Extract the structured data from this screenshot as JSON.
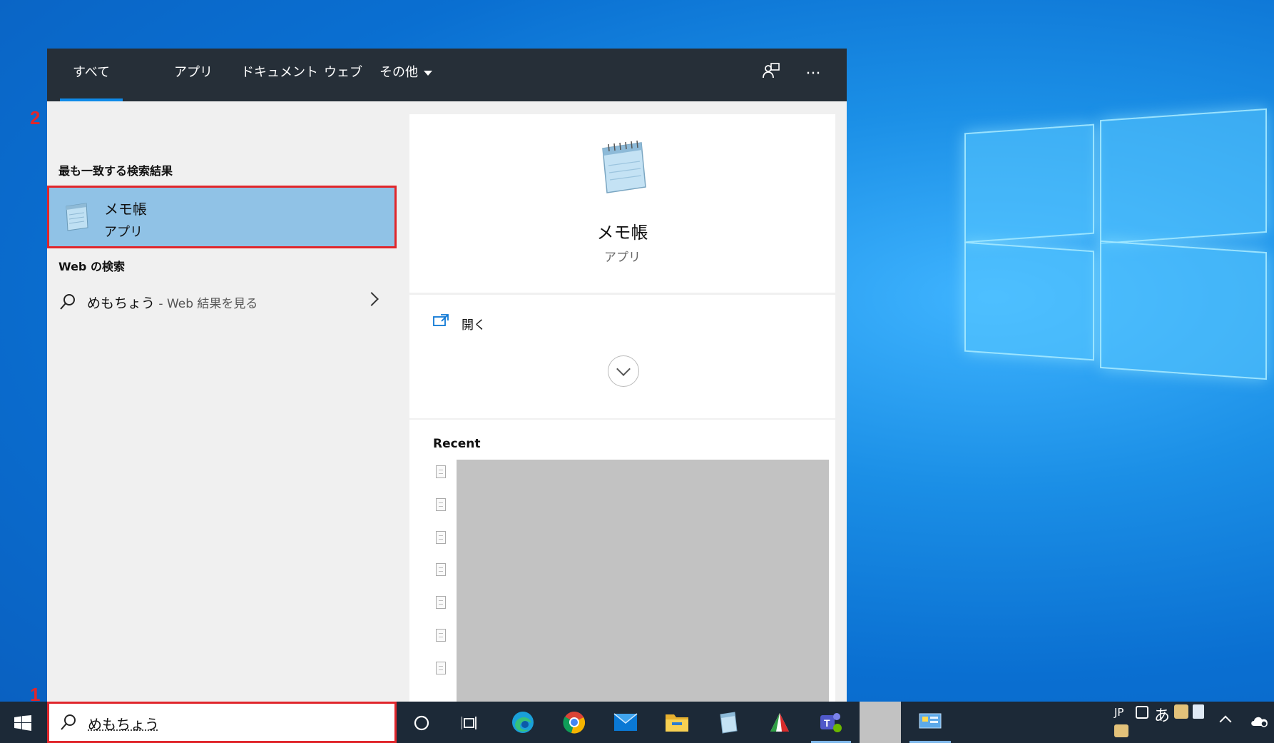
{
  "annotations": {
    "step1": "1",
    "step2": "2"
  },
  "tabs": [
    {
      "label": "すべて",
      "active": true
    },
    {
      "label": "アプリ"
    },
    {
      "label": "ドキュメント"
    },
    {
      "label": "ウェブ"
    },
    {
      "label": "その他",
      "dropdown": true
    }
  ],
  "top_icons": {
    "feedback": "feedback-icon",
    "more": "···"
  },
  "best_match": {
    "section_title": "最も一致する検索結果",
    "name": "メモ帳",
    "type": "アプリ"
  },
  "web": {
    "section_title": "Web の検索",
    "query": "めもちょう",
    "suffix": " - Web 結果を見る"
  },
  "preview": {
    "app_name": "メモ帳",
    "app_type": "アプリ",
    "open_label": "開く",
    "recent_title": "Recent"
  },
  "search_box": {
    "value": "めもちょう"
  },
  "tray": {
    "lang": "JP",
    "ime": "あ"
  },
  "colors": {
    "accent": "#0e8ae8",
    "highlight": "#90c2e6",
    "annotation": "#e0262b",
    "topbar": "#262f38"
  }
}
